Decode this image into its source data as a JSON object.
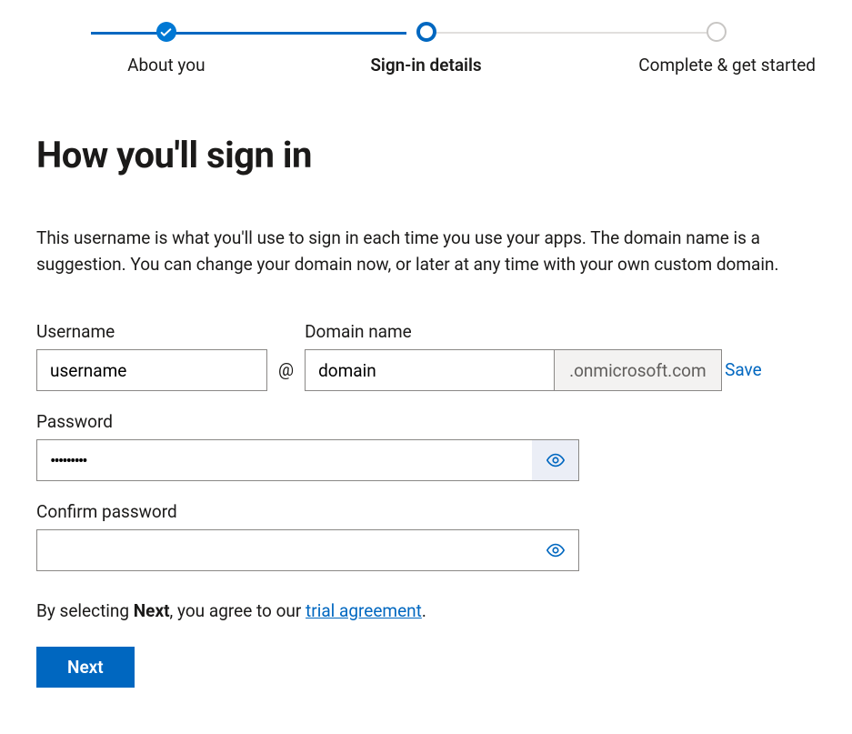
{
  "stepper": {
    "steps": [
      {
        "label": "About you",
        "state": "completed"
      },
      {
        "label": "Sign-in details",
        "state": "active"
      },
      {
        "label": "Complete & get started",
        "state": "pending"
      }
    ]
  },
  "heading": "How you'll sign in",
  "description": "This username is what you'll use to sign in each time you use your apps. The domain name is a suggestion. You can change your domain now, or later at any time with your own custom domain.",
  "form": {
    "username_label": "Username",
    "username_value": "username",
    "at": "@",
    "domain_label": "Domain name",
    "domain_value": "domain",
    "domain_suffix": ".onmicrosoft.com",
    "save_label": "Save",
    "password_label": "Password",
    "password_value": "•••••••••",
    "confirm_label": "Confirm password",
    "confirm_value": ""
  },
  "agreement": {
    "prefix": "By selecting ",
    "bold": "Next",
    "middle": ", you agree to our ",
    "link": "trial agreement",
    "suffix": "."
  },
  "next_button": "Next"
}
